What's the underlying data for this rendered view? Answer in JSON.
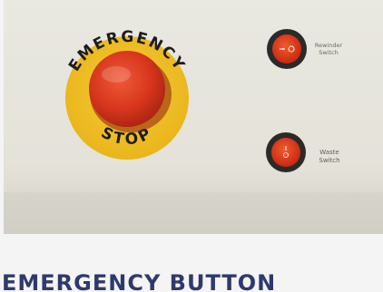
{
  "photo": {
    "panel_color": "#e7e5dc",
    "stop_button_color": "#d8361d",
    "stop_ring_color": "#f2c021",
    "ring_text_top": "EMERGENCY",
    "ring_text_bottom": "STOP",
    "switch_color": "#e03b1e",
    "rewinder_label_line1": "Rewinder",
    "rewinder_label_line2": "Switch",
    "waste_label_line1": "Waste",
    "waste_label_line2": "Switch"
  },
  "caption": {
    "title": "EMERGENCY BUTTON"
  }
}
